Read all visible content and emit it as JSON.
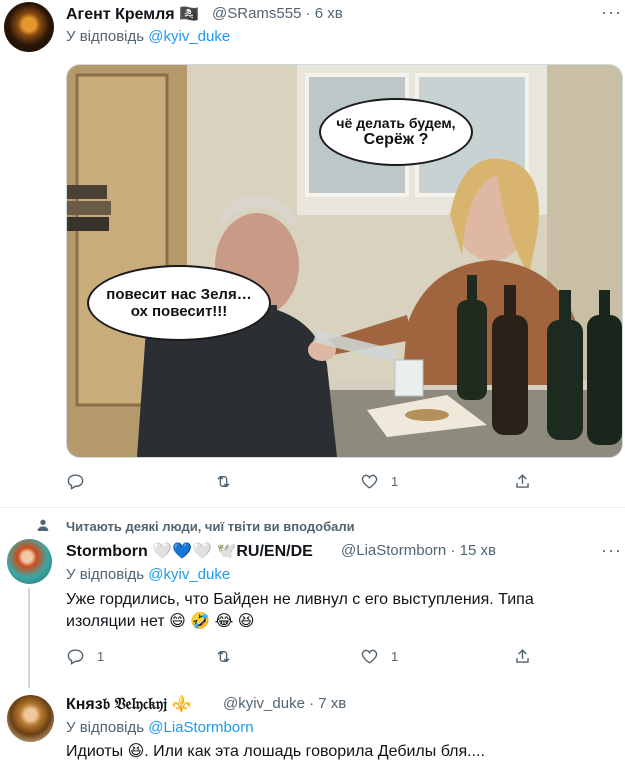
{
  "tweet1": {
    "name": "Агент Кремля",
    "name_emoji": "🏴‍☠️",
    "handle": "@SRams555",
    "time": "6 хв",
    "reply_prefix": "У відповідь",
    "reply_to": "@kyiv_duke",
    "meme": {
      "bubble_left_line1": "повесит нас Зеля…",
      "bubble_left_line2": "ох повесит!!!",
      "bubble_right_line1": "чё делать будем,",
      "bubble_right_line2": "Серёж ?"
    },
    "likes": "1"
  },
  "social_context": "Читають деякі люди, чиї твіти ви вподобали",
  "tweet2": {
    "name": "Stormborn",
    "name_emoji": "🤍💙🤍",
    "name_suffix": "🕊️RU/EN/DE",
    "handle": "@LiaStormborn",
    "time": "15 хв",
    "reply_prefix": "У відповідь",
    "reply_to": "@kyiv_duke",
    "text_line1": "Уже гордились, что Байден не ливнул с его выступления. Типа",
    "text_line2": "изоляции нет 😄 🤣 😂 😆",
    "replies": "1",
    "likes": "1"
  },
  "tweet3": {
    "name": "Княз𝔟 𝔙𝔢𝔩𝔶𝔠𝔨𝔶𝔧",
    "name_emoji": "⚜️",
    "handle": "@kyiv_duke",
    "time": "7 хв",
    "reply_prefix": "У відповідь",
    "reply_to": "@LiaStormborn",
    "text": "Идиоты 😆. Или как эта лошадь говорила Дебилы бля...."
  },
  "more_label": "···"
}
